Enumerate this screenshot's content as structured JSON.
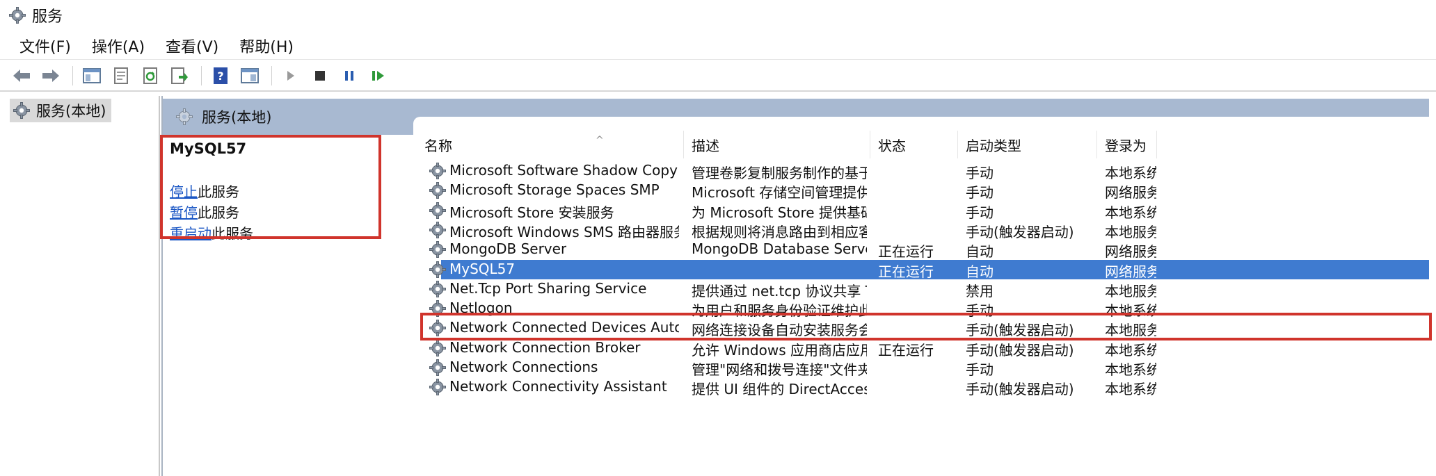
{
  "window": {
    "title": "服务"
  },
  "menu": [
    "文件(F)",
    "操作(A)",
    "查看(V)",
    "帮助(H)"
  ],
  "toolbar": {
    "buttons": [
      "back-icon",
      "forward-icon",
      "show-hide-tree-icon",
      "properties-icon",
      "refresh-icon",
      "export-list-icon",
      "help-icon",
      "view-icon",
      "start-service-icon",
      "stop-service-icon",
      "pause-service-icon",
      "restart-service-icon"
    ]
  },
  "tree": {
    "item": "服务(本地)"
  },
  "pane": {
    "header": "服务(本地)"
  },
  "detail": {
    "service_name": "MySQL57",
    "actions": [
      {
        "link": "停止",
        "rest": "此服务"
      },
      {
        "link": "暂停",
        "rest": "此服务"
      },
      {
        "link": "重启动",
        "rest": "此服务"
      }
    ]
  },
  "columns": {
    "name": "名称",
    "desc": "描述",
    "status": "状态",
    "startup": "启动类型",
    "logon": "登录为"
  },
  "rows": [
    {
      "name": "Microsoft Software Shadow Copy Provider",
      "desc": "管理卷影复制服务制作的基于软...",
      "status": "",
      "startup": "手动",
      "logon": "本地系统"
    },
    {
      "name": "Microsoft Storage Spaces SMP",
      "desc": "Microsoft 存储空间管理提供程序...",
      "status": "",
      "startup": "手动",
      "logon": "网络服务"
    },
    {
      "name": "Microsoft Store 安装服务",
      "desc": "为 Microsoft Store 提供基础结构...",
      "status": "",
      "startup": "手动",
      "logon": "本地系统"
    },
    {
      "name": "Microsoft Windows SMS 路由器服务。",
      "desc": "根据规则将消息路由到相应客户",
      "status": "",
      "startup": "手动(触发器启动)",
      "logon": "本地服务"
    },
    {
      "name": "MongoDB Server",
      "desc": "MongoDB Database Server",
      "status": "正在运行",
      "startup": "自动",
      "logon": "网络服务"
    },
    {
      "name": "MySQL57",
      "desc": "",
      "status": "正在运行",
      "startup": "自动",
      "logon": "网络服务",
      "selected": true
    },
    {
      "name": "Net.Tcp Port Sharing Service",
      "desc": "提供通过 net.tcp 协议共享 TCP ...",
      "status": "",
      "startup": "禁用",
      "logon": "本地服务"
    },
    {
      "name": "Netlogon",
      "desc": "为用户和服务身份验证维护此计...",
      "status": "",
      "startup": "手动",
      "logon": "本地系统"
    },
    {
      "name": "Network Connected Devices Auto-Setup",
      "desc": "网络连接设备自动安装服务会监...",
      "status": "",
      "startup": "手动(触发器启动)",
      "logon": "本地服务"
    },
    {
      "name": "Network Connection Broker",
      "desc": "允许 Windows 应用商店应用从 In...",
      "status": "正在运行",
      "startup": "手动(触发器启动)",
      "logon": "本地系统"
    },
    {
      "name": "Network Connections",
      "desc": "管理\"网络和拨号连接\"文件夹中对...",
      "status": "",
      "startup": "手动",
      "logon": "本地系统"
    },
    {
      "name": "Network Connectivity Assistant",
      "desc": "提供 UI 组件的 DirectAccess 状态",
      "status": "",
      "startup": "手动(触发器启动)",
      "logon": "本地系统"
    }
  ],
  "colors": {
    "selection": "#3f7bd0",
    "header_band": "#a8b9d1",
    "highlight_box": "#d0342c",
    "link": "#1a56c4"
  }
}
